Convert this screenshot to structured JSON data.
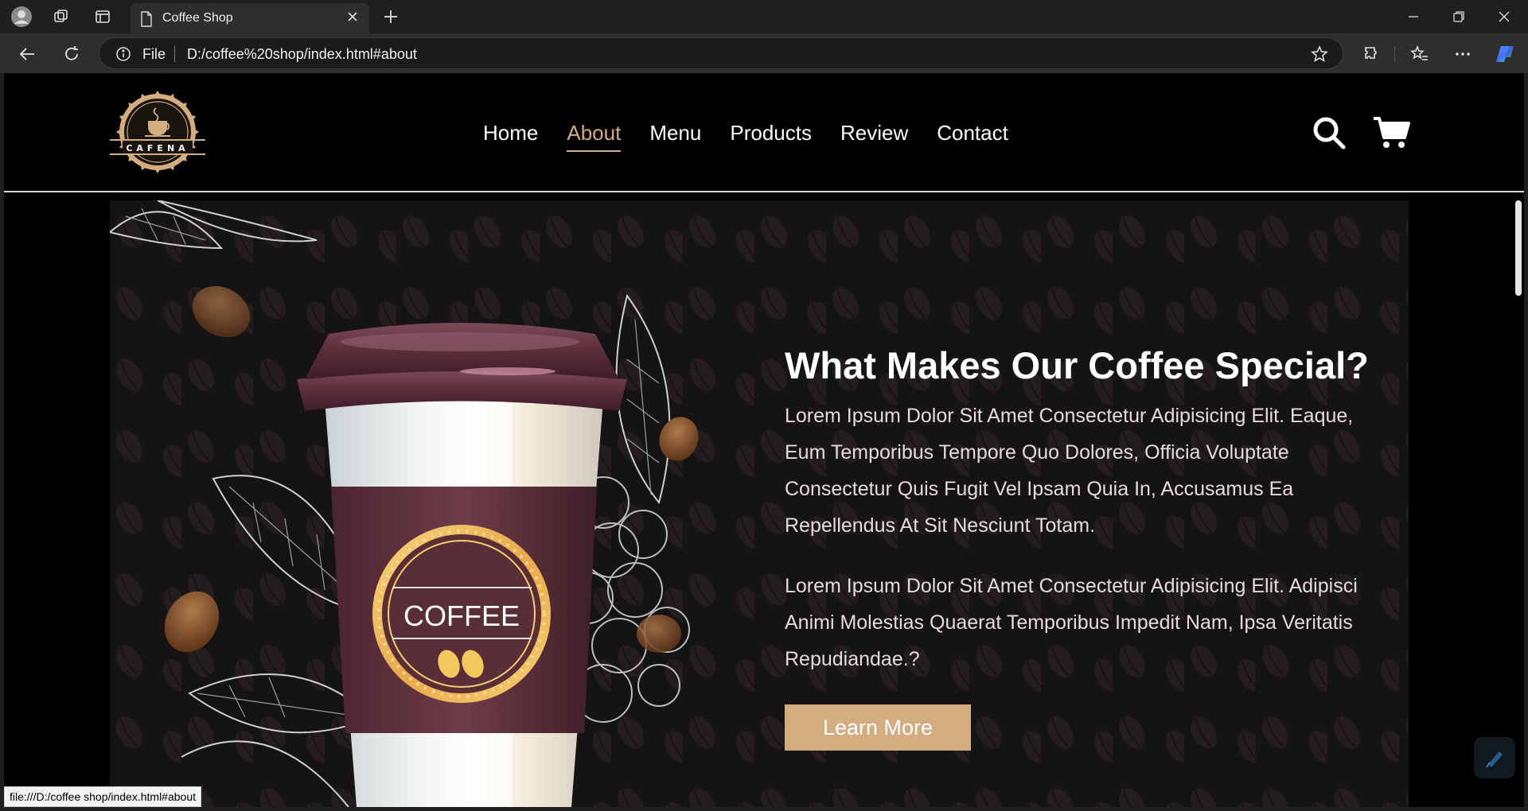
{
  "browser": {
    "tab_title": "Coffee Shop",
    "url_scheme_label": "File",
    "url": "D:/coffee%20shop/index.html#about",
    "status_url": "file:///D:/coffee shop/index.html#about"
  },
  "site": {
    "logo_text": "CAFENA",
    "nav": [
      {
        "label": "Home",
        "active": false
      },
      {
        "label": "About",
        "active": true
      },
      {
        "label": "Menu",
        "active": false
      },
      {
        "label": "Products",
        "active": false
      },
      {
        "label": "Review",
        "active": false
      },
      {
        "label": "Contact",
        "active": false
      }
    ],
    "icons": [
      "search-icon",
      "cart-icon"
    ]
  },
  "about": {
    "title": "What Makes Our Coffee Special?",
    "paragraph1": "Lorem Ipsum Dolor Sit Amet Consectetur Adipisicing Elit. Eaque, Eum Temporibus Tempore Quo Dolores, Officia Voluptate Consectetur Quis Fugit Vel Ipsam Quia In, Accusamus Ea Repellendus At Sit Nesciunt Totam.",
    "paragraph2": "Lorem Ipsum Dolor Sit Amet Consectetur Adipisicing Elit. Adipisci Animi Molestias Quaerat Temporibus Impedit Nam, Ipsa Veritatis Repudiandae.?",
    "button_label": "Learn More",
    "cup_label": "COFFEE"
  },
  "colors": {
    "accent": "#d3ad7f",
    "page_bg": "#000000",
    "section_bg": "#161313",
    "cup_sleeve": "#5a2e36"
  }
}
